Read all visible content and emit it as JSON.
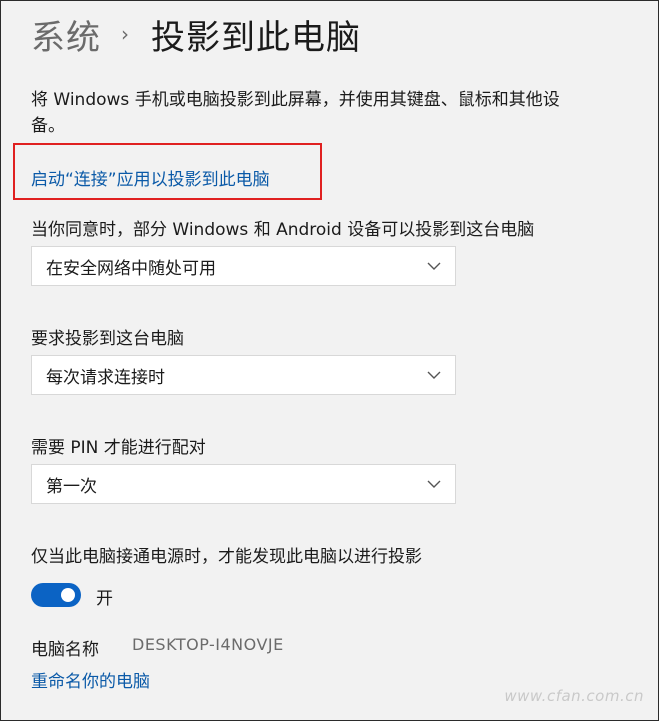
{
  "breadcrumb": {
    "parent": "系统",
    "separator": "›",
    "current": "投影到此电脑"
  },
  "description": "将 Windows 手机或电脑投影到此屏幕，并使用其键盘、鼠标和其他设备。",
  "launch_connect_link": "启动“连接”应用以投影到此电脑",
  "availability": {
    "label": "当你同意时，部分 Windows 和 Android 设备可以投影到这台电脑",
    "selected": "在安全网络中随处可用"
  },
  "ask_to_project": {
    "label": "要求投影到这台电脑",
    "selected": "每次请求连接时"
  },
  "require_pin": {
    "label": "需要 PIN 才能进行配对",
    "selected": "第一次"
  },
  "power_discovery": {
    "label": "仅当此电脑接通电源时，才能发现此电脑以进行投影",
    "toggle_state": "开",
    "toggle_on": true
  },
  "pc_name": {
    "label": "电脑名称",
    "value": "DESKTOP-I4NOVJE"
  },
  "rename_link": "重命名你的电脑",
  "watermark": "www.cfan.com.cn",
  "colors": {
    "link": "#0b5aa8",
    "toggle_on": "#0b63c4",
    "highlight": "#e02020",
    "background": "#f2f2f2"
  }
}
